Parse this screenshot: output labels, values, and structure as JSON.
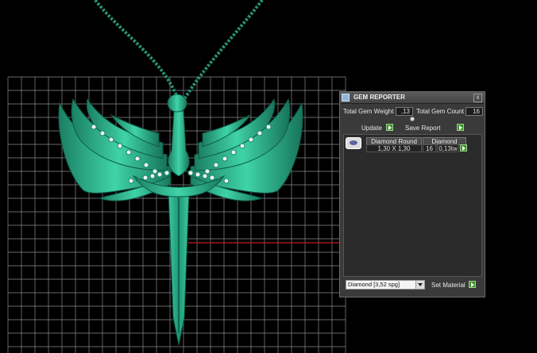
{
  "panel": {
    "title": "GEM REPORTER",
    "close_glyph": "x",
    "total_weight_label": "Total Gem Weight",
    "total_weight_value": ",13",
    "total_count_label": "Total Gem Count",
    "total_count_value": "16",
    "update_label": "Update",
    "save_report_label": "Save Report",
    "gems": [
      {
        "name": "Diamond Round",
        "size": "1,30 X 1,30",
        "material": "Diamond",
        "count": "16",
        "weight": "0,13tw"
      }
    ],
    "material_select_value": "Diamond    [3,52 spg]",
    "set_material_label": "Set Material"
  },
  "icons": {
    "app": "gem-reporter-icon",
    "close": "close-icon",
    "go": "green-play-arrow-icon",
    "dropdown": "chevron-down-icon"
  },
  "colors": {
    "model": "#2fb894",
    "grid": "#8a8a8a",
    "axis": "#c02020",
    "panel_bg": "#3a3a3a",
    "button": "#3f8f2f"
  }
}
